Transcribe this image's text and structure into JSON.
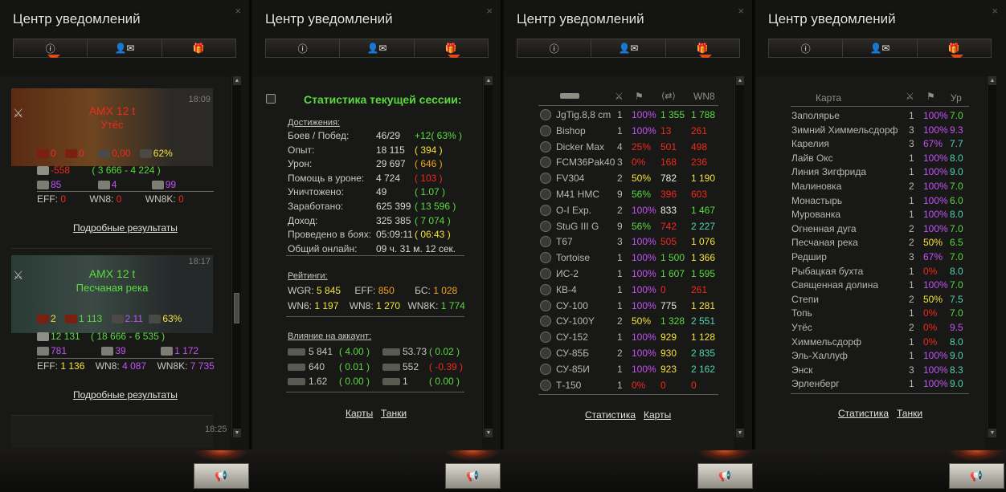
{
  "panels": [
    {
      "title": "Центр уведомлений"
    },
    {
      "title": "Центр уведомлений"
    },
    {
      "title": "Центр уведомлений"
    },
    {
      "title": "Центр уведомлений"
    }
  ],
  "tabs": {
    "info": "ⓘ",
    "messages": "👤✉",
    "gifts": "🎁"
  },
  "close_label": "×",
  "panel1": {
    "items": [
      {
        "time": "18:09",
        "tank": "AMX 12 t",
        "map": "Утёс",
        "dmg_in": "0",
        "dmg_out": "0",
        "avg": "0,00",
        "pct": "62%",
        "xp": "-558",
        "credits": "( 3 666 - 4 224 )",
        "s1": "85",
        "s2": "4",
        "s3": "99",
        "eff": "0",
        "wn8": "0",
        "wn8k": "0",
        "link": "Подробные результаты"
      },
      {
        "time": "18:17",
        "tank": "AMX 12 t",
        "map": "Песчаная река",
        "dmg_in": "2",
        "dmg_out": "1 113",
        "avg": "2.11",
        "pct": "63%",
        "n2": "2",
        "xp": "12 131",
        "credits": "( 18 666 - 6 535 )",
        "s1": "781",
        "s2": "39",
        "s3": "1 172",
        "eff": "1 136",
        "wn8": "4 087",
        "wn8k": "7 735",
        "link": "Подробные результаты"
      }
    ],
    "last_time": "18:25",
    "labels": {
      "eff": "EFF:",
      "wn8": "WN8:",
      "wn8k": "WN8K:"
    }
  },
  "panel2": {
    "title": "Статистика текущей сессии:",
    "achievements_header": "Достижения:",
    "rows": [
      {
        "k": "Боев / Побед:",
        "v": "46/29",
        "d": "+12( 63% )"
      },
      {
        "k": "Опыт:",
        "v": "18 115",
        "d": "( 394 )"
      },
      {
        "k": "Урон:",
        "v": "29 697",
        "d": "( 646 )"
      },
      {
        "k": "Помощь в уроне:",
        "v": "4 724",
        "d": "( 103 )"
      },
      {
        "k": "Уничтожено:",
        "v": "49",
        "d": "( 1.07 )"
      },
      {
        "k": "Заработано:",
        "v": "625 399",
        "d": "( 13 596 )"
      },
      {
        "k": "Доход:",
        "v": "325 385",
        "d": "( 7 074 )"
      },
      {
        "k": "Проведено в боях:",
        "v": "05:09:11",
        "d": "( 06:43 )"
      },
      {
        "k": "Общий онлайн:",
        "v": "09 ч. 31 м. 12 сек.",
        "d": ""
      }
    ],
    "ratings_header": "Рейтинги:",
    "ratings": {
      "wgr_l": "WGR:",
      "wgr": "5 845",
      "eff_l": "EFF:",
      "eff": "850",
      "bs_l": "БС:",
      "bs": "1 028",
      "wn6_l": "WN6:",
      "wn6": "1 197",
      "wn8_l": "WN8:",
      "wn8": "1 270",
      "wn8k_l": "WN8K:",
      "wn8k": "1 774"
    },
    "influence_header": "Влияние на аккаунт:",
    "influence": [
      {
        "a": "5 841",
        "b": "( 4.00 )",
        "c": "53.73",
        "d": "( 0.02 )"
      },
      {
        "a": "640",
        "b": "( 0.01 )",
        "c": "552",
        "d": "( -0.39 )"
      },
      {
        "a": "1.62",
        "b": "( 0.00 )",
        "c": "1",
        "d": "( 0.00 )"
      }
    ],
    "links": [
      "Карты",
      "Танки"
    ]
  },
  "panel3": {
    "header": {
      "wn8": "WN8"
    },
    "rows": [
      {
        "n": "JgTig.8,8 cm",
        "b": "1",
        "w": "100%",
        "d": "1 355",
        "r": "1 788",
        "wc": "pur",
        "dc": "green",
        "rc": "green"
      },
      {
        "n": "Bishop",
        "b": "1",
        "w": "100%",
        "d": "13",
        "r": "261",
        "wc": "pur",
        "dc": "red",
        "rc": "red"
      },
      {
        "n": "Dicker Max",
        "b": "4",
        "w": "25%",
        "d": "501",
        "r": "498",
        "wc": "red",
        "dc": "red",
        "rc": "red"
      },
      {
        "n": "FCM36Pak40",
        "b": "3",
        "w": "0%",
        "d": "168",
        "r": "236",
        "wc": "red",
        "dc": "red",
        "rc": "red"
      },
      {
        "n": "FV304",
        "b": "2",
        "w": "50%",
        "d": "782",
        "r": "1 190",
        "wc": "yel",
        "dc": "white",
        "rc": "yel"
      },
      {
        "n": "M41 HMC",
        "b": "9",
        "w": "56%",
        "d": "396",
        "r": "603",
        "wc": "green",
        "dc": "red",
        "rc": "red"
      },
      {
        "n": "O-I Exp.",
        "b": "2",
        "w": "100%",
        "d": "833",
        "r": "1 467",
        "wc": "pur",
        "dc": "white",
        "rc": "green"
      },
      {
        "n": "StuG III G",
        "b": "9",
        "w": "56%",
        "d": "742",
        "r": "2 227",
        "wc": "green",
        "dc": "red",
        "rc": "teal"
      },
      {
        "n": "T67",
        "b": "3",
        "w": "100%",
        "d": "505",
        "r": "1 076",
        "wc": "pur",
        "dc": "red",
        "rc": "yel"
      },
      {
        "n": "Tortoise",
        "b": "1",
        "w": "100%",
        "d": "1 500",
        "r": "1 366",
        "wc": "pur",
        "dc": "green",
        "rc": "yel"
      },
      {
        "n": "ИС-2",
        "b": "1",
        "w": "100%",
        "d": "1 607",
        "r": "1 595",
        "wc": "pur",
        "dc": "green",
        "rc": "green"
      },
      {
        "n": "КВ-4",
        "b": "1",
        "w": "100%",
        "d": "0",
        "r": "261",
        "wc": "pur",
        "dc": "red",
        "rc": "red"
      },
      {
        "n": "СУ-100",
        "b": "1",
        "w": "100%",
        "d": "775",
        "r": "1 281",
        "wc": "pur",
        "dc": "white",
        "rc": "yel"
      },
      {
        "n": "СУ-100Y",
        "b": "2",
        "w": "50%",
        "d": "1 328",
        "r": "2 551",
        "wc": "yel",
        "dc": "green",
        "rc": "teal"
      },
      {
        "n": "СУ-152",
        "b": "1",
        "w": "100%",
        "d": "929",
        "r": "1 128",
        "wc": "pur",
        "dc": "yel",
        "rc": "yel"
      },
      {
        "n": "СУ-85Б",
        "b": "2",
        "w": "100%",
        "d": "930",
        "r": "2 835",
        "wc": "pur",
        "dc": "yel",
        "rc": "teal"
      },
      {
        "n": "СУ-85И",
        "b": "1",
        "w": "100%",
        "d": "923",
        "r": "2 162",
        "wc": "pur",
        "dc": "yel",
        "rc": "teal"
      },
      {
        "n": "Т-150",
        "b": "1",
        "w": "0%",
        "d": "0",
        "r": "0",
        "wc": "red",
        "dc": "red",
        "rc": "red"
      }
    ],
    "links": [
      "Статистика",
      "Карты"
    ]
  },
  "panel4": {
    "header": {
      "map": "Карта",
      "lvl": "Ур"
    },
    "rows": [
      {
        "n": "Заполярье",
        "b": "1",
        "w": "100%",
        "l": "7.0",
        "wc": "pur",
        "lc": "green"
      },
      {
        "n": "Зимний Химмельсдорф",
        "b": "3",
        "w": "100%",
        "l": "9.3",
        "wc": "pur",
        "lc": "pur"
      },
      {
        "n": "Карелия",
        "b": "3",
        "w": "67%",
        "l": "7.7",
        "wc": "pur",
        "lc": "teal"
      },
      {
        "n": "Лайв Окс",
        "b": "1",
        "w": "100%",
        "l": "8.0",
        "wc": "pur",
        "lc": "teal"
      },
      {
        "n": "Линия Зигфрида",
        "b": "1",
        "w": "100%",
        "l": "9.0",
        "wc": "pur",
        "lc": "teal"
      },
      {
        "n": "Малиновка",
        "b": "2",
        "w": "100%",
        "l": "7.0",
        "wc": "pur",
        "lc": "green"
      },
      {
        "n": "Монастырь",
        "b": "1",
        "w": "100%",
        "l": "6.0",
        "wc": "pur",
        "lc": "green"
      },
      {
        "n": "Мурованка",
        "b": "1",
        "w": "100%",
        "l": "8.0",
        "wc": "pur",
        "lc": "teal"
      },
      {
        "n": "Огненная дуга",
        "b": "2",
        "w": "100%",
        "l": "7.0",
        "wc": "pur",
        "lc": "green"
      },
      {
        "n": "Песчаная река",
        "b": "2",
        "w": "50%",
        "l": "6.5",
        "wc": "yel",
        "lc": "green"
      },
      {
        "n": "Редшир",
        "b": "3",
        "w": "67%",
        "l": "7.0",
        "wc": "pur",
        "lc": "green"
      },
      {
        "n": "Рыбацкая бухта",
        "b": "1",
        "w": "0%",
        "l": "8.0",
        "wc": "red",
        "lc": "teal"
      },
      {
        "n": "Священная долина",
        "b": "1",
        "w": "100%",
        "l": "7.0",
        "wc": "pur",
        "lc": "green"
      },
      {
        "n": "Степи",
        "b": "2",
        "w": "50%",
        "l": "7.5",
        "wc": "yel",
        "lc": "teal"
      },
      {
        "n": "Топь",
        "b": "1",
        "w": "0%",
        "l": "7.0",
        "wc": "red",
        "lc": "green"
      },
      {
        "n": "Утёс",
        "b": "2",
        "w": "0%",
        "l": "9.5",
        "wc": "red",
        "lc": "pur"
      },
      {
        "n": "Химмельсдорф",
        "b": "1",
        "w": "0%",
        "l": "8.0",
        "wc": "red",
        "lc": "teal"
      },
      {
        "n": "Эль-Халлуф",
        "b": "1",
        "w": "100%",
        "l": "9.0",
        "wc": "pur",
        "lc": "teal"
      },
      {
        "n": "Энск",
        "b": "3",
        "w": "100%",
        "l": "8.3",
        "wc": "pur",
        "lc": "teal"
      },
      {
        "n": "Эрленберг",
        "b": "1",
        "w": "100%",
        "l": "9.0",
        "wc": "pur",
        "lc": "teal"
      }
    ],
    "links": [
      "Статистика",
      "Танки"
    ]
  },
  "footer": {
    "button_icon": "megaphone-icon"
  }
}
